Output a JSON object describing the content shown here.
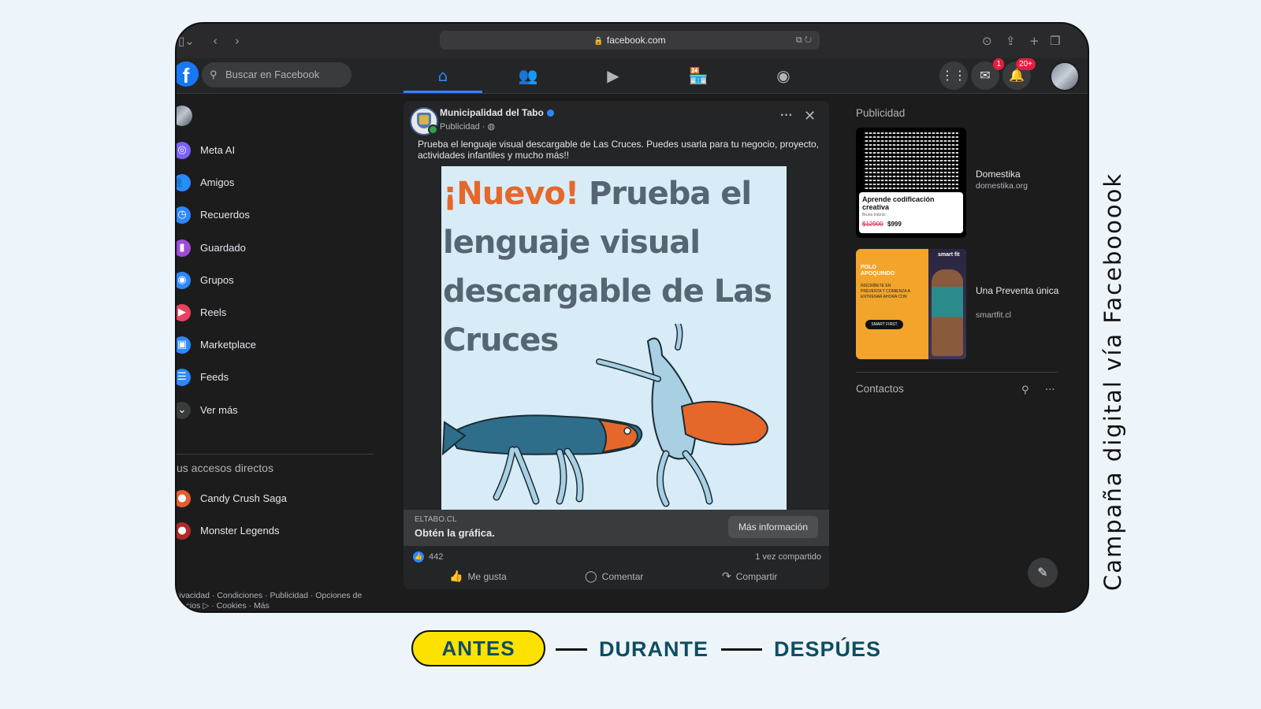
{
  "browser": {
    "url": "facebook.com",
    "icons": [
      "sidebar-toggle-icon",
      "back-icon",
      "forward-icon",
      "lock-icon",
      "translate-icon",
      "reload-icon",
      "download-icon",
      "share-icon",
      "new-tab-icon",
      "tabs-icon"
    ]
  },
  "fb_nav": {
    "logo_letter": "f",
    "search_placeholder": "Buscar en Facebook",
    "tabs": [
      "home-icon",
      "friends-icon",
      "video-icon",
      "marketplace-icon",
      "groups-icon"
    ],
    "messenger_badge": "1",
    "notifications_badge": "20+"
  },
  "sidebar": {
    "items": [
      {
        "label": "Meta AI",
        "icon": "meta-ai-icon",
        "color": "#7b61ff"
      },
      {
        "label": "Amigos",
        "icon": "friends-icon",
        "color": "#2d88ff"
      },
      {
        "label": "Recuerdos",
        "icon": "clock-icon",
        "color": "#2d88ff"
      },
      {
        "label": "Guardado",
        "icon": "bookmark-icon",
        "color": "#a04bd8"
      },
      {
        "label": "Grupos",
        "icon": "groups-icon",
        "color": "#2d88ff"
      },
      {
        "label": "Reels",
        "icon": "reels-icon",
        "color": "#e8425e"
      },
      {
        "label": "Marketplace",
        "icon": "marketplace-icon",
        "color": "#2d88ff"
      },
      {
        "label": "Feeds",
        "icon": "feeds-icon",
        "color": "#2d88ff"
      },
      {
        "label": "Ver más",
        "icon": "chevron-down-icon",
        "color": "#3a3b3c"
      }
    ],
    "shortcuts_heading": "us accesos directos",
    "shortcuts": [
      {
        "label": "Candy Crush Saga",
        "icon": "candy-crush-icon",
        "color": "#e85b2a"
      },
      {
        "label": "Monster Legends",
        "icon": "monster-legends-icon",
        "color": "#b22a2a"
      }
    ],
    "footer_line1": "rivacidad · Condiciones · Publicidad · Opciones de",
    "footer_line2": "uncios ▷ · Cookies · Más"
  },
  "post": {
    "page_name": "Municipalidad del Tabo",
    "subtitle": "Publicidad · ◍",
    "text": "Prueba el lenguaje visual descargable de Las Cruces. Puedes usarla para tu negocio, proyecto, actividades infantiles y mucho más!!",
    "image": {
      "headline_accent": "¡Nuevo!",
      "headline_rest": " Prueba el lenguaje visual descargable de Las Cruces",
      "colors": {
        "background": "#d7ecf7",
        "accent": "#e5682a",
        "text": "#566573"
      }
    },
    "cta": {
      "domain": "ELTABO.CL",
      "title": "Obtén la gráfica.",
      "button": "Más información"
    },
    "likes": "442",
    "shares": "1 vez compartido",
    "actions": {
      "like": "Me gusta",
      "comment": "Comentar",
      "share": "Compartir"
    }
  },
  "right_column": {
    "ads_heading": "Publicidad",
    "ads": [
      {
        "name": "Domestika",
        "domain": "domestika.org",
        "thumb_title": "Aprende codificación creativa",
        "thumb_sub": "Bruno Imbrizi",
        "price_old": "$12900",
        "price_new": "$999"
      },
      {
        "name": "Una Preventa única",
        "domain": "smartfit.cl",
        "thumb_head": "POLO APOQUINDO",
        "thumb_body": "INSCRÍBETE EN PREVENTA Y COMIENZA A ENTRENAR AHORA CON",
        "thumb_pill": "SMART FIRST",
        "thumb_brand": "smart fit"
      }
    ],
    "contacts_heading": "Contactos"
  },
  "caption": "Campaña digital vía Facebooook",
  "timeline": {
    "stages": [
      "ANTES",
      "DURANTE",
      "DESPÚES"
    ],
    "active": "ANTES",
    "colors": {
      "active_fill": "#fde200",
      "text": "#0e4d62"
    }
  }
}
